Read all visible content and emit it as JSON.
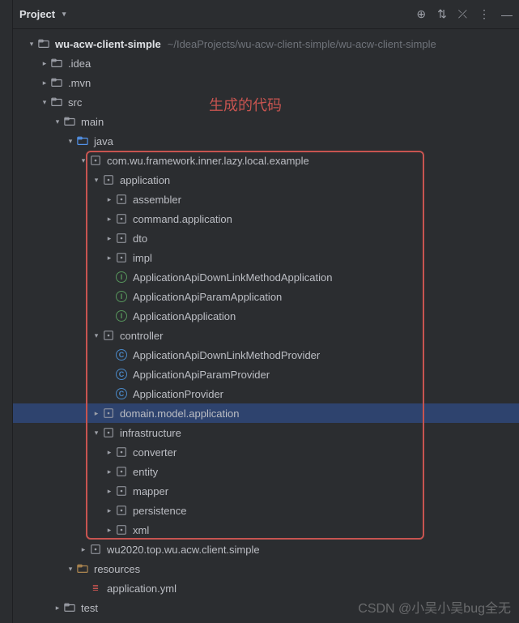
{
  "header": {
    "title": "Project",
    "actions": {
      "select_opened": "⊕",
      "expand": "⇅",
      "collapse": "⤫",
      "more": "⋮",
      "hide": "—"
    }
  },
  "root": {
    "name": "wu-acw-client-simple",
    "path": "~/IdeaProjects/wu-acw-client-simple/wu-acw-client-simple"
  },
  "tree": {
    "idea": ".idea",
    "mvn": ".mvn",
    "src": "src",
    "main": "main",
    "java": "java",
    "pkg_example": "com.wu.framework.inner.lazy.local.example",
    "application": "application",
    "assembler": "assembler",
    "command_application": "command.application",
    "dto": "dto",
    "impl": "impl",
    "app_downlink": "ApplicationApiDownLinkMethodApplication",
    "app_param": "ApplicationApiParamApplication",
    "app_app": "ApplicationApplication",
    "controller": "controller",
    "prov_downlink": "ApplicationApiDownLinkMethodProvider",
    "prov_param": "ApplicationApiParamProvider",
    "prov_app": "ApplicationProvider",
    "domain_model": "domain.model.application",
    "infrastructure": "infrastructure",
    "converter": "converter",
    "entity": "entity",
    "mapper": "mapper",
    "persistence": "persistence",
    "xml": "xml",
    "wu2020": "wu2020.top.wu.acw.client.simple",
    "resources": "resources",
    "application_yml": "application.yml",
    "test": "test"
  },
  "annotation": "生成的代码",
  "watermark": "CSDN @小吴小吴bug全无",
  "icons": {
    "interface": "I",
    "class": "C"
  }
}
